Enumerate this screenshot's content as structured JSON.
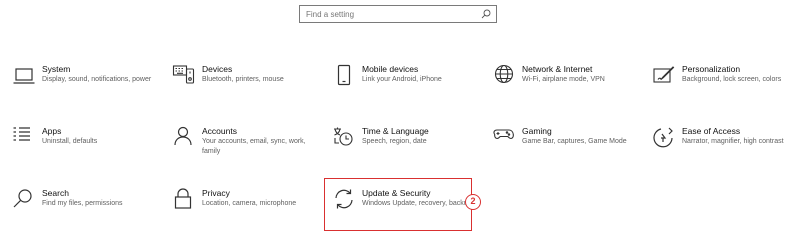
{
  "search": {
    "placeholder": "Find a setting"
  },
  "categories": [
    {
      "title": "System",
      "desc": "Display, sound, notifications, power",
      "icon": "laptop-icon"
    },
    {
      "title": "Devices",
      "desc": "Bluetooth, printers, mouse",
      "icon": "keyboard-icon"
    },
    {
      "title": "Mobile devices",
      "desc": "Link your Android, iPhone",
      "icon": "phone-icon"
    },
    {
      "title": "Network & Internet",
      "desc": "Wi-Fi, airplane mode, VPN",
      "icon": "globe-icon"
    },
    {
      "title": "Personalization",
      "desc": "Background, lock screen, colors",
      "icon": "paint-brush-icon"
    },
    {
      "title": "Apps",
      "desc": "Uninstall, defaults",
      "icon": "apps-list-icon"
    },
    {
      "title": "Accounts",
      "desc": "Your accounts, email, sync, work, family",
      "icon": "person-icon"
    },
    {
      "title": "Time & Language",
      "desc": "Speech, region, date",
      "icon": "time-language-icon"
    },
    {
      "title": "Gaming",
      "desc": "Game Bar, captures, Game Mode",
      "icon": "gamepad-icon"
    },
    {
      "title": "Ease of Access",
      "desc": "Narrator, magnifier, high contrast",
      "icon": "ease-of-access-icon"
    },
    {
      "title": "Search",
      "desc": "Find my files, permissions",
      "icon": "search-icon"
    },
    {
      "title": "Privacy",
      "desc": "Location, camera, microphone",
      "icon": "lock-icon"
    },
    {
      "title": "Update & Security",
      "desc": "Windows Update, recovery, backup",
      "icon": "refresh-icon"
    }
  ],
  "annotation": {
    "label": "2",
    "color": "#d93030"
  }
}
